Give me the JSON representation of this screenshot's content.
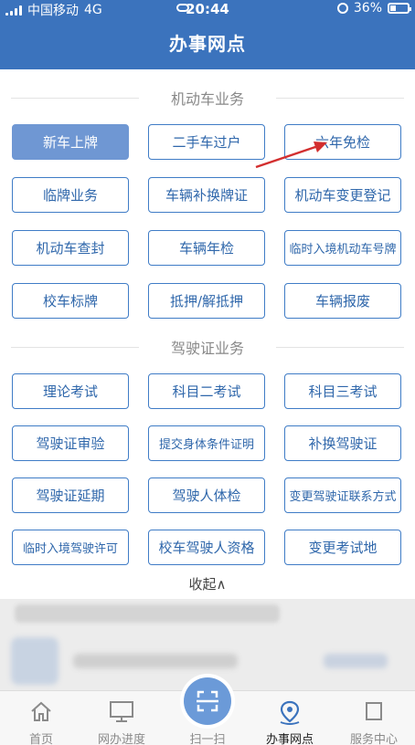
{
  "status": {
    "carrier": "中国移动",
    "network": "4G",
    "time": "20:44",
    "battery": "36%",
    "battery_level": 0.36
  },
  "header": {
    "title": "办事网点"
  },
  "vehicle": {
    "title": "机动车业务",
    "buttons": [
      "新车上牌",
      "二手车过户",
      "六年免检",
      "临牌业务",
      "车辆补换牌证",
      "机动车变更登记",
      "机动车查封",
      "车辆年检",
      "临时入境机动车号牌",
      "校车标牌",
      "抵押/解抵押",
      "车辆报废"
    ]
  },
  "license": {
    "title": "驾驶证业务",
    "buttons": [
      "理论考试",
      "科目二考试",
      "科目三考试",
      "驾驶证审验",
      "提交身体条件证明",
      "补换驾驶证",
      "驾驶证延期",
      "驾驶人体检",
      "变更驾驶证联系方式",
      "临时入境驾驶许可",
      "校车驾驶人资格",
      "变更考试地"
    ]
  },
  "collapse": {
    "label": "收起∧"
  },
  "tabs": [
    {
      "label": "首页",
      "icon": "home-icon"
    },
    {
      "label": "网办进度",
      "icon": "monitor-icon"
    },
    {
      "label": "扫一扫",
      "icon": "scan-icon"
    },
    {
      "label": "办事网点",
      "icon": "location-icon"
    },
    {
      "label": "服务中心",
      "icon": "service-icon"
    }
  ],
  "colors": {
    "primary": "#3b73bd",
    "button_border": "#3f7cc6",
    "active_button": "#6f97d3",
    "arrow": "#d32f2f"
  }
}
